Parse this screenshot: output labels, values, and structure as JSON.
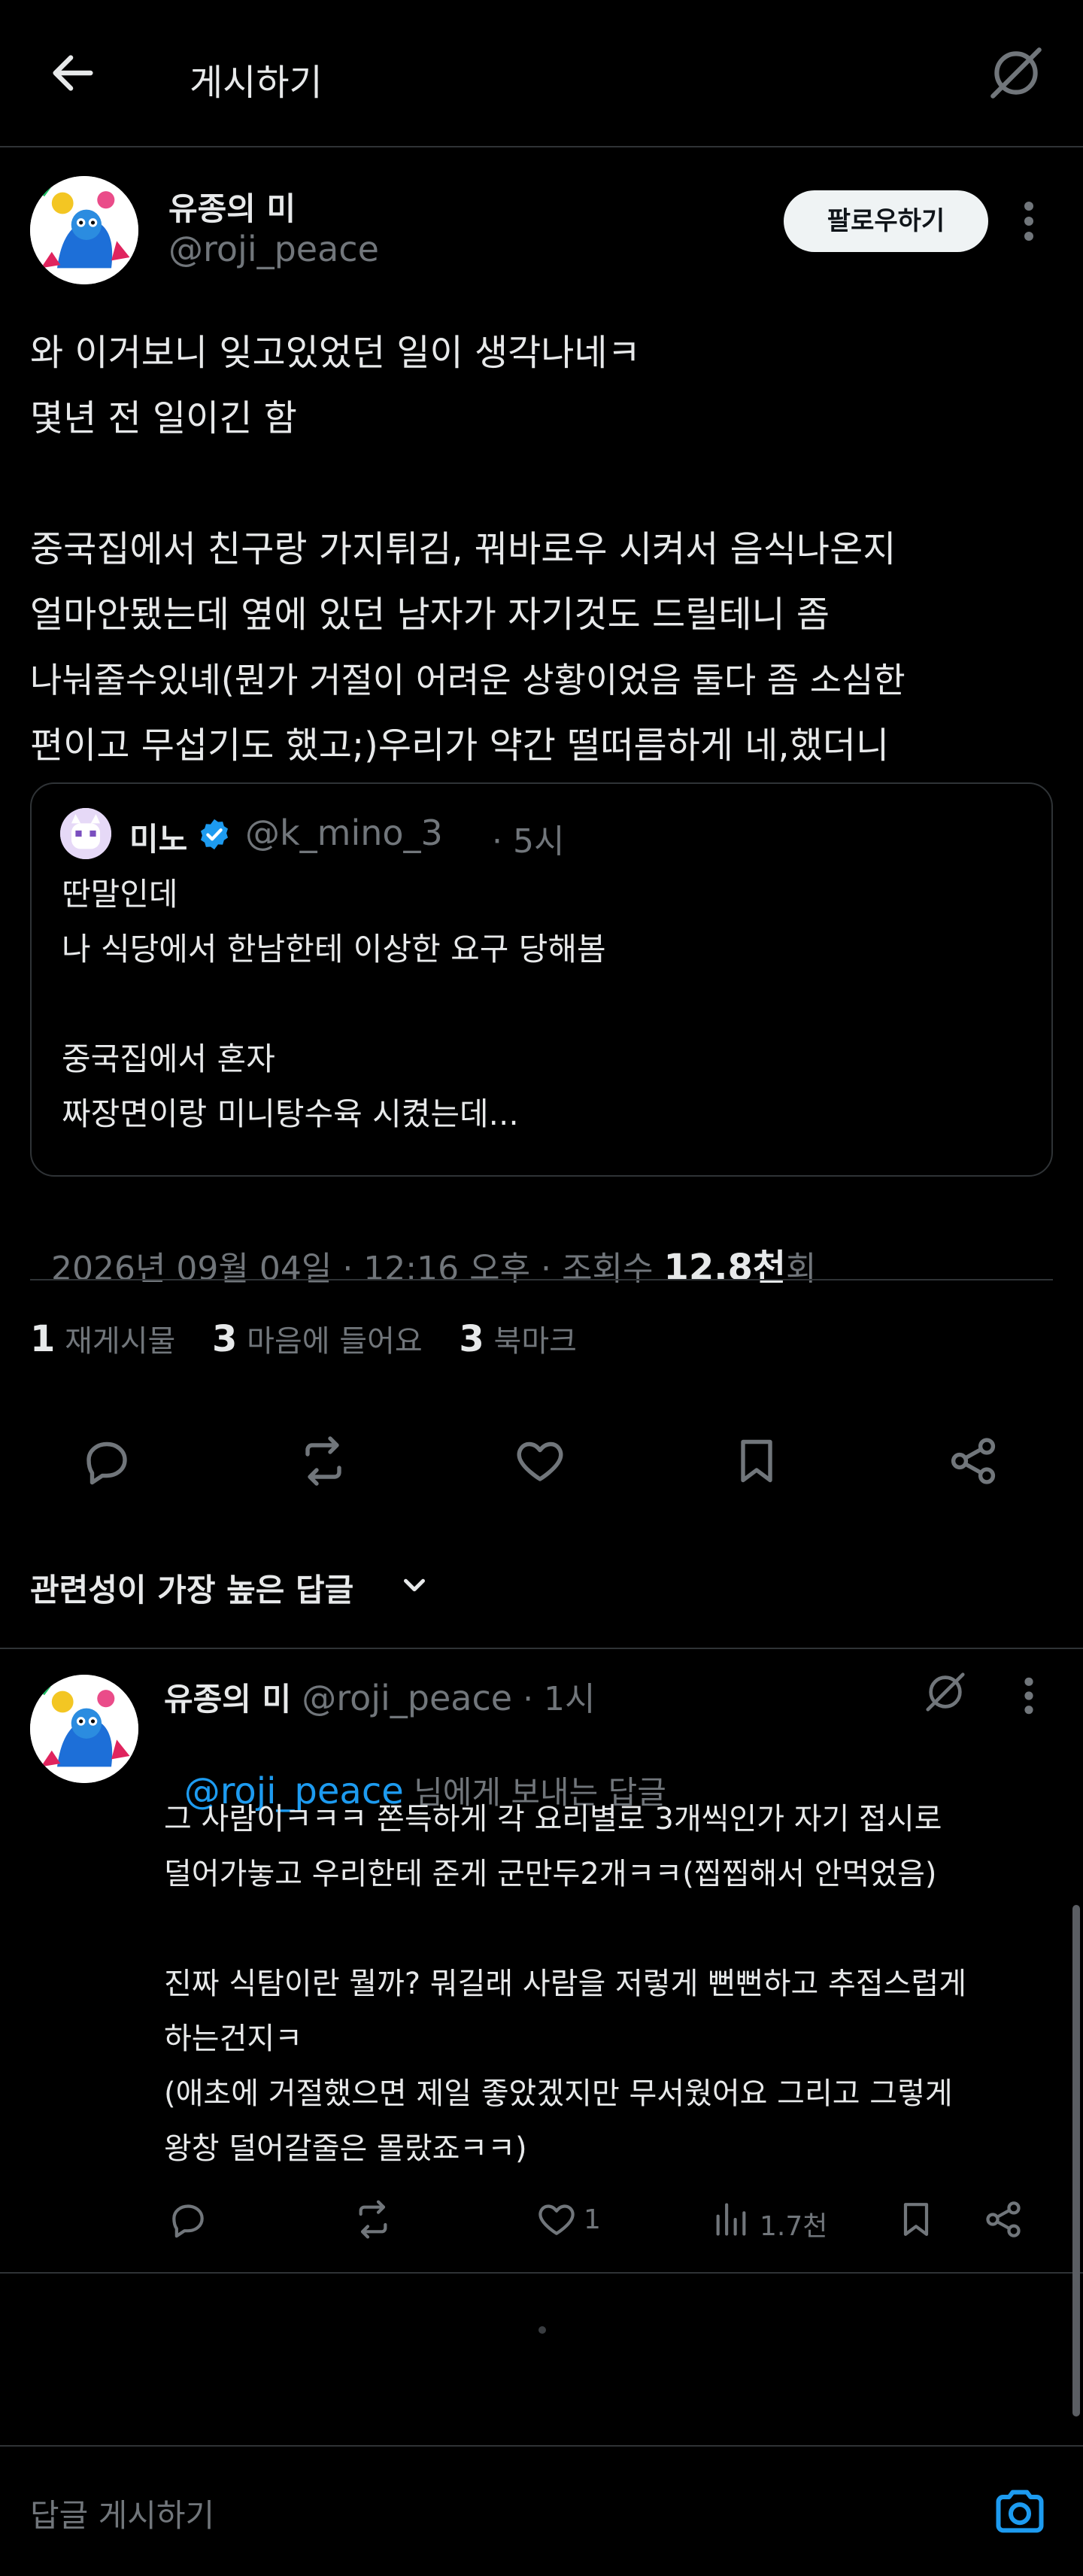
{
  "header": {
    "title": "게시하기"
  },
  "post": {
    "author_name": "유종의 미",
    "author_handle": "@roji_peace",
    "follow_label": "팔로우하기",
    "lines": [
      "와 이거보니 잊고있었던 일이 생각나네ㅋ",
      "몇년 전 일이긴 함",
      "",
      "중국집에서 친구랑 가지튀김, 꿔바로우 시켜서 음식나온지",
      "얼마안됐는데 옆에 있던 남자가 자기것도 드릴테니 좀",
      "나눠줄수있녜(뭔가 거절이 어려운 상황이었음 둘다 좀 소심한",
      "편이고 무섭기도 했고;)우리가 약간 떨떠름하게 네,했더니"
    ],
    "quote": {
      "name": "미노",
      "handle": "@k_mino_3",
      "time": "· 5시",
      "lines": [
        "딴말인데",
        "나 식당에서 한남한테 이상한 요구 당해봄",
        "",
        "중국집에서 혼자",
        "짜장면이랑 미니탕수육 시켰는데..."
      ]
    },
    "meta_date": "2026년 09월 04일 · 12:16 오후 · 조회수 ",
    "meta_views": "12.8천",
    "meta_views_suffix": "회",
    "stats": {
      "reposts_num": "1",
      "reposts_label": "재게시물",
      "likes_num": "3",
      "likes_label": "마음에 들어요",
      "bookmarks_num": "3",
      "bookmarks_label": "북마크"
    }
  },
  "sort": {
    "label": "관련성이 가장 높은 답글"
  },
  "reply": {
    "author_name": "유종의 미",
    "author_handle": "@roji_peace",
    "time": "· 1시",
    "replying_to_handle": "@roji_peace",
    "replying_to_suffix": " 님에게 보내는 답글",
    "lines": [
      "그 사람이ㅋㅋㅋ 쫀득하게 각 요리별로 3개씩인가 자기 접시로",
      "덜어가놓고 우리한테 준게 군만두2개ㅋㅋ(찝찝해서 안먹었음)",
      "",
      "진짜 식탐이란 뭘까? 뭐길래 사람을 저렇게 뻔뻔하고 추접스럽게",
      "하는건지ㅋ",
      "(애초에 거절했으면 제일 좋았겠지만 무서웠어요 그리고 그렇게",
      "왕창 덜어갈줄은 몰랐죠ㅋㅋ)"
    ],
    "like_count": "1",
    "views_count": "1.7천"
  },
  "composer": {
    "placeholder": "답글 게시하기"
  },
  "colors": {
    "background": "#000000",
    "text": "#e7e9ea",
    "muted": "#71767b",
    "link": "#1d9bf0",
    "verified": "#1d9bf0",
    "divider": "#2f3336"
  },
  "icons": {
    "back": "arrow-left-icon",
    "grok": "grok-icon",
    "more": "more-vertical-icon",
    "reply": "reply-icon",
    "repost": "repost-icon",
    "like": "heart-icon",
    "bookmark": "bookmark-icon",
    "share": "share-icon",
    "views": "views-icon",
    "chevron": "chevron-down-icon",
    "camera": "camera-icon",
    "verified": "verified-badge-icon"
  }
}
